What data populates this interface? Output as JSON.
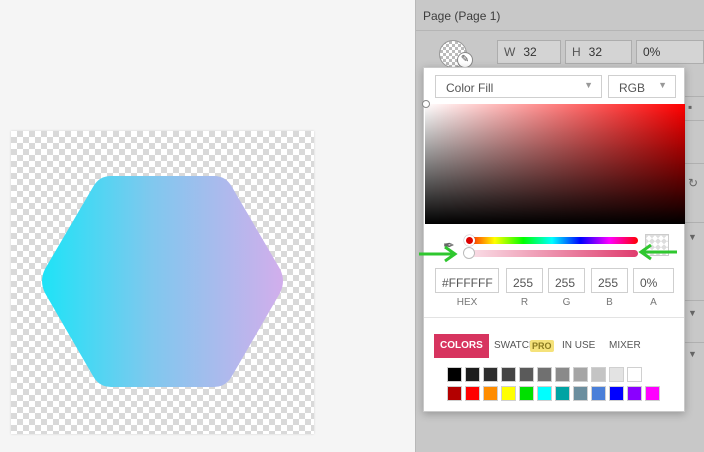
{
  "panel": {
    "title": "Page (Page 1)",
    "width_label": "W",
    "width_value": "32",
    "height_label": "H",
    "height_value": "32",
    "opacity_value": "0%"
  },
  "picker": {
    "fill_type": "Color Fill",
    "color_mode": "RGB",
    "hex": "#FFFFFF",
    "r": "255",
    "g": "255",
    "b": "255",
    "a": "0%",
    "labels": {
      "hex": "HEX",
      "r": "R",
      "g": "G",
      "b": "B",
      "a": "A"
    },
    "tabs": {
      "colors": "COLORS",
      "swatches": "SWATCHES",
      "pro": "PRO",
      "in_use": "IN USE",
      "mixer": "MIXER"
    },
    "swatch_colors_row1": [
      "#000000",
      "#1c1c1c",
      "#2e2e2e",
      "#444444",
      "#5a5a5a",
      "#707070",
      "#8a8a8a",
      "#a5a5a5",
      "#c4c4c4",
      "#e3e3e3",
      "#ffffff"
    ],
    "swatch_colors_row2": [
      "#b30000",
      "#ff0000",
      "#ff8c00",
      "#ffff00",
      "#00e000",
      "#00ffff",
      "#00a3a3",
      "#6b8e9e",
      "#4a7fd9",
      "#0000ff",
      "#8a00ff",
      "#ff00ff"
    ]
  },
  "shape": {
    "gradient_start": "#1ee3f7",
    "gradient_end": "#d2aeec"
  },
  "annotations": {
    "arrow_color": "#2fc72f"
  }
}
